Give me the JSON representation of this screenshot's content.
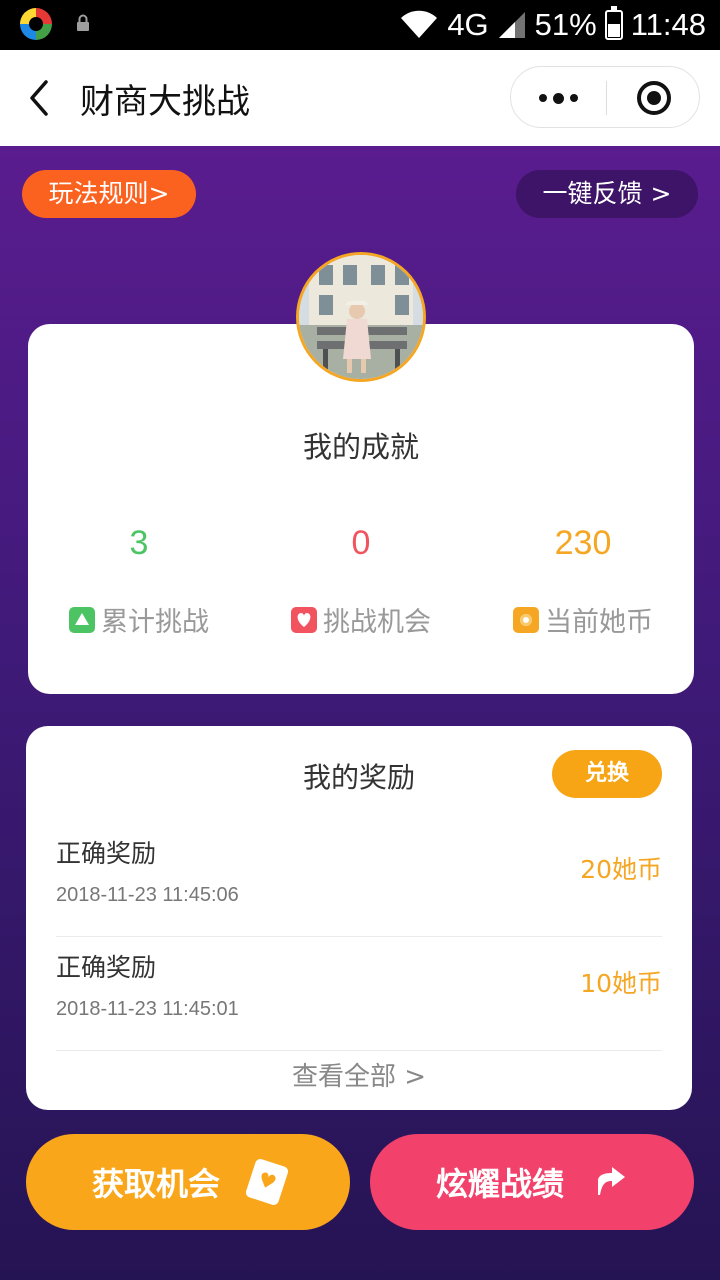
{
  "status_bar": {
    "network": "4G",
    "battery": "51%",
    "time": "11:48"
  },
  "nav": {
    "title": "财商大挑战"
  },
  "actions": {
    "rules": "玩法规则>",
    "feedback": "一键反馈 >"
  },
  "achievements": {
    "title": "我的成就",
    "stats": [
      {
        "value": "3",
        "label": "累计挑战",
        "color": "#4cc464",
        "icon": "triangle-icon"
      },
      {
        "value": "0",
        "label": "挑战机会",
        "color": "#f1545e",
        "icon": "heart-icon"
      },
      {
        "value": "230",
        "label": "当前她币",
        "color": "#f5a623",
        "icon": "coin-icon"
      }
    ]
  },
  "rewards": {
    "title": "我的奖励",
    "exchange": "兑换",
    "items": [
      {
        "name": "正确奖励",
        "time": "2018-11-23 11:45:06",
        "amount": "20她币"
      },
      {
        "name": "正确奖励",
        "time": "2018-11-23 11:45:01",
        "amount": "10她币"
      }
    ],
    "view_all": "查看全部 >"
  },
  "buttons": {
    "get_chance": "获取机会",
    "show_results": "炫耀战绩"
  },
  "colors": {
    "accent_orange": "#f9a61b",
    "accent_pink": "#f2416b",
    "purple": "#5a1c8f"
  }
}
